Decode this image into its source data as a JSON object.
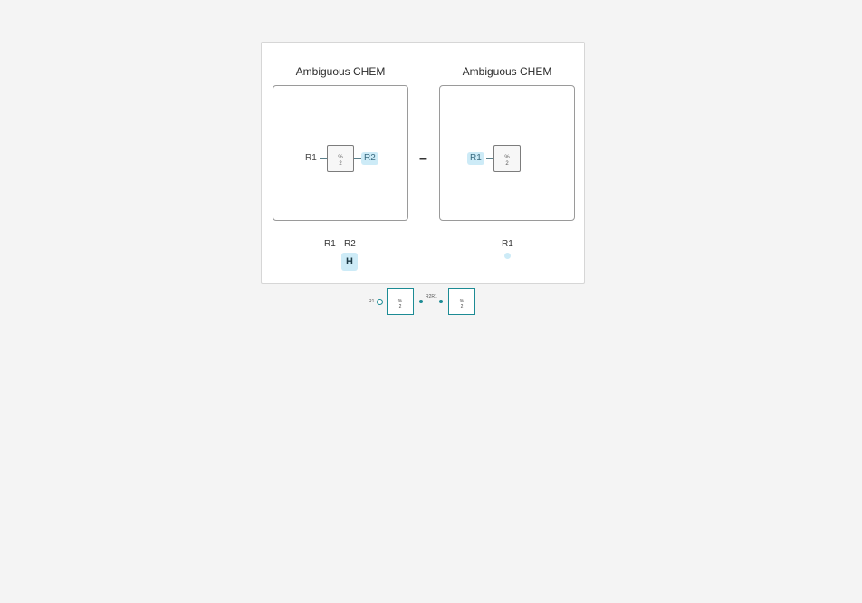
{
  "panels": [
    {
      "title": "Ambiguous CHEM",
      "glyph_line1": "%",
      "glyph_line2": "2",
      "left_label": "R1",
      "right_label": "R2",
      "below_labels": [
        "R1",
        "R2"
      ],
      "below_chip": "H"
    },
    {
      "title": "Ambiguous CHEM",
      "glyph_line1": "%",
      "glyph_line2": "2",
      "left_label": "R1",
      "below_labels": [
        "R1"
      ]
    }
  ],
  "operator": "–",
  "sequence": {
    "start_label": "R1",
    "bond_label": "R2R1",
    "box1_line1": "%",
    "box1_line2": "2",
    "box2_line1": "%",
    "box2_line2": "2"
  },
  "colors": {
    "selection": "#cdebf7",
    "sequence_accent": "#1c8b94"
  }
}
